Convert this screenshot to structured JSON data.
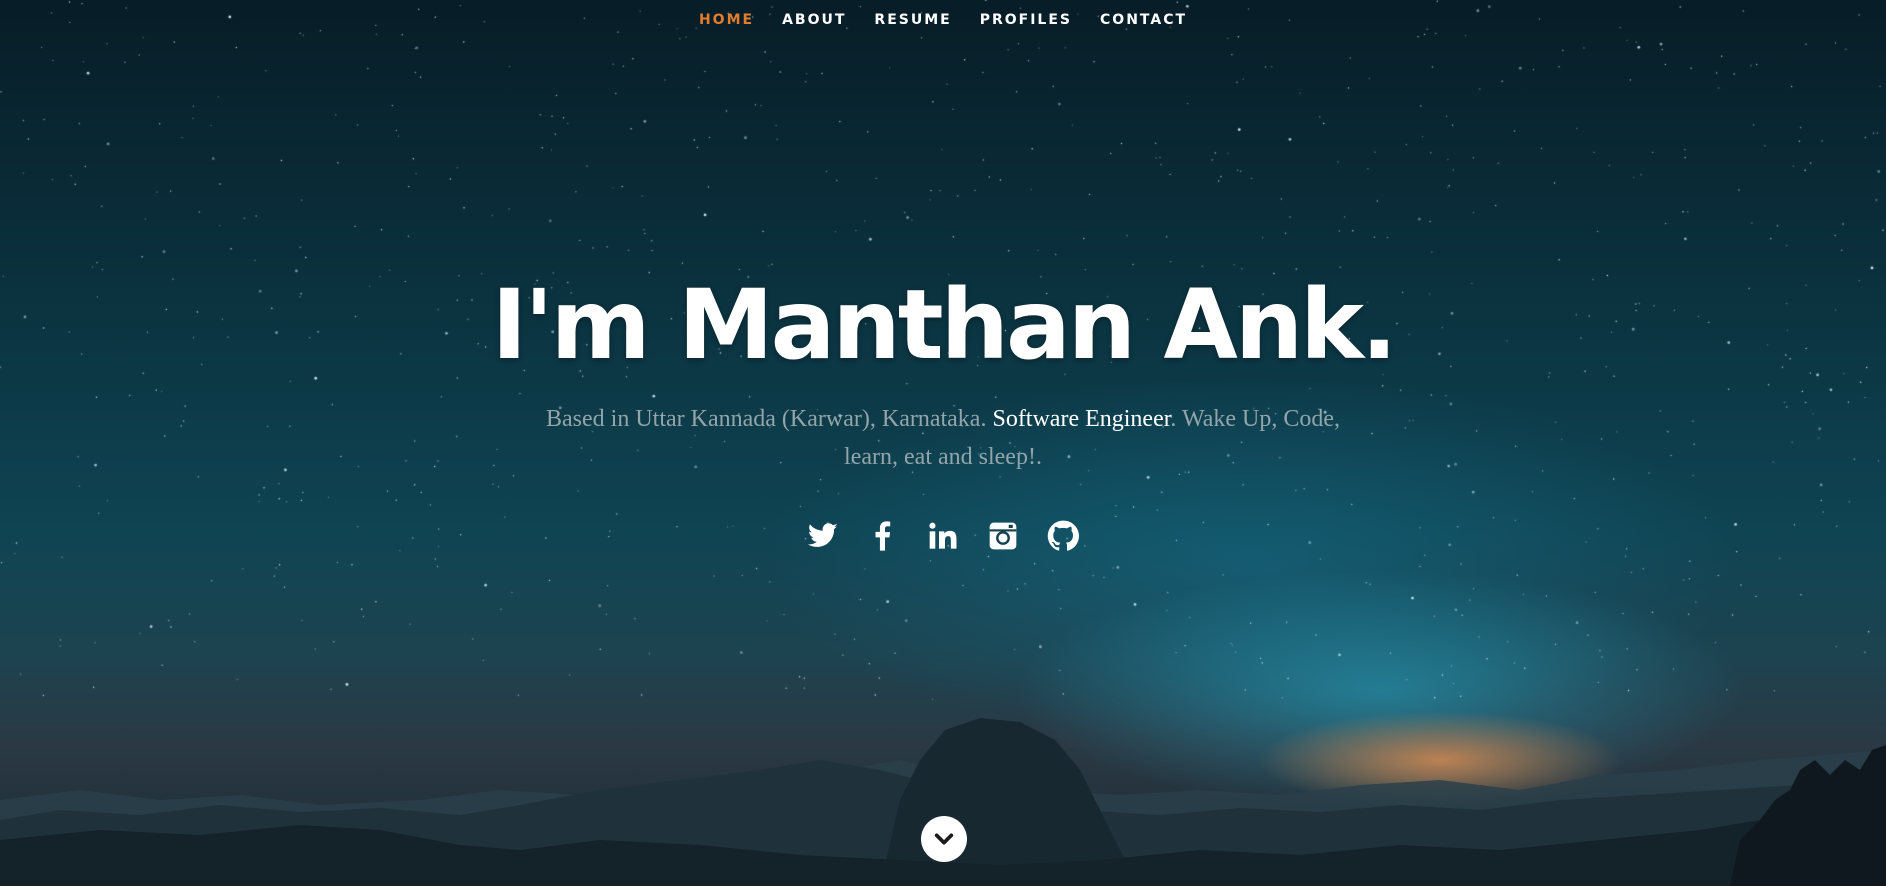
{
  "nav": {
    "items": [
      {
        "label": "HOME",
        "active": true
      },
      {
        "label": "ABOUT",
        "active": false
      },
      {
        "label": "RESUME",
        "active": false
      },
      {
        "label": "PROFILES",
        "active": false
      },
      {
        "label": "CONTACT",
        "active": false
      }
    ],
    "active_color": "#e27d2d"
  },
  "hero": {
    "headline": "I'm Manthan Ank.",
    "tagline_before": "Based in Uttar Kannada (Karwar), Karnataka. ",
    "tagline_highlight": "Software Engineer",
    "tagline_after": ". Wake Up, Code, learn, eat and sleep!."
  },
  "social": [
    {
      "icon": "twitter-icon"
    },
    {
      "icon": "facebook-icon"
    },
    {
      "icon": "linkedin-icon"
    },
    {
      "icon": "instagram-icon"
    },
    {
      "icon": "github-icon"
    }
  ],
  "scroll_button": {
    "icon": "chevron-down-icon"
  }
}
